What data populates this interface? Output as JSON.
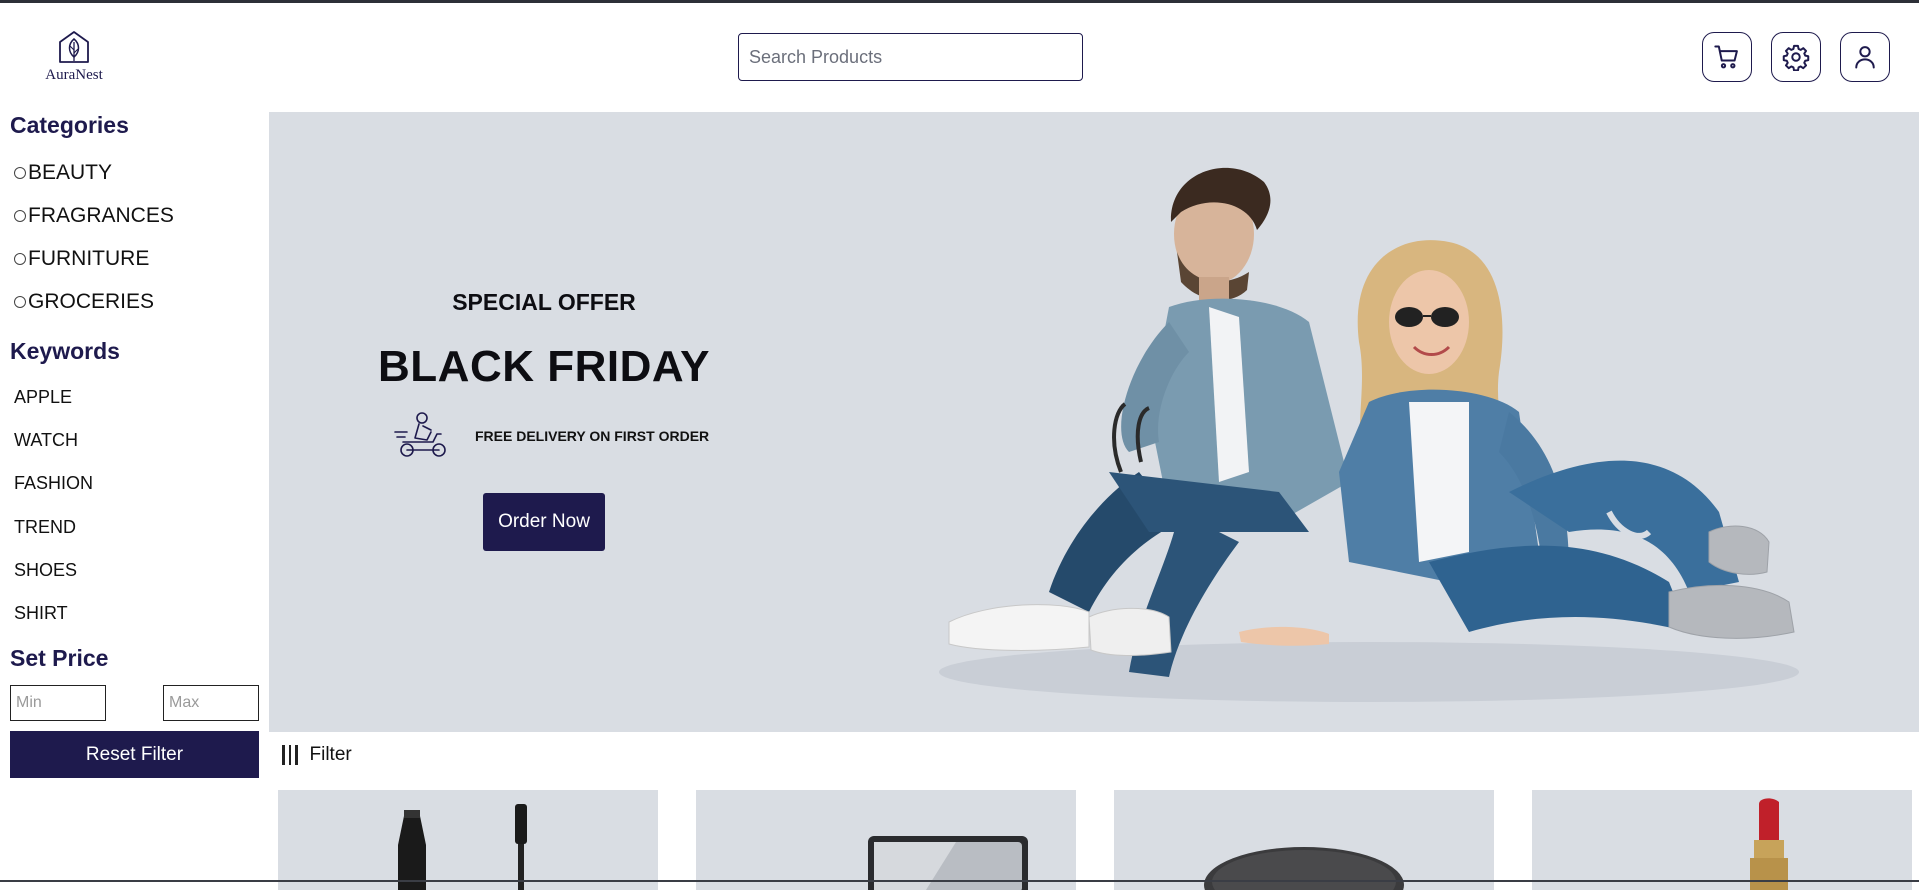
{
  "header": {
    "logo_text": "AuraNest",
    "logo_icon": "leaf-house-icon",
    "search_placeholder": "Search Products",
    "icons": [
      "cart-icon",
      "gear-icon",
      "user-icon"
    ]
  },
  "sidebar": {
    "categories_title": "Categories",
    "categories": [
      "BEAUTY",
      "FRAGRANCES",
      "FURNITURE",
      "GROCERIES"
    ],
    "keywords_title": "Keywords",
    "keywords": [
      "APPLE",
      "WATCH",
      "FASHION",
      "TREND",
      "SHOES",
      "SHIRT"
    ],
    "price_title": "Set Price",
    "min_placeholder": "Min",
    "max_placeholder": "Max",
    "reset_label": "Reset Filter"
  },
  "hero": {
    "eyebrow": "SPECIAL OFFER",
    "title": "BLACK FRIDAY",
    "delivery_text": "FREE DELIVERY ON FIRST ORDER",
    "delivery_icon": "scooter-delivery-icon",
    "cta_label": "Order Now"
  },
  "filter": {
    "label": "Filter",
    "icon": "filter-bars-icon"
  },
  "products": [
    {
      "image": "mascara-product-image"
    },
    {
      "image": "mirror-compact-product-image"
    },
    {
      "image": "powder-jar-product-image"
    },
    {
      "image": "lipstick-product-image"
    }
  ],
  "colors": {
    "brand": "#1e1a4d",
    "hero_bg": "#d9dde3",
    "background": "#ffffff"
  }
}
